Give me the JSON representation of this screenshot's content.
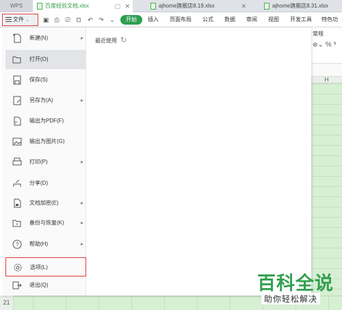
{
  "tabs": {
    "app_label": "WPS",
    "items": [
      {
        "label": "百度经验文档.xlsx"
      },
      {
        "label": "ajhome旗舰店8.19.xlsx"
      },
      {
        "label": "ajhome旗舰店8.31.xlsx"
      }
    ]
  },
  "menubar": {
    "file_label": "文件",
    "start_label": "开始",
    "items": [
      "插入",
      "页面布局",
      "公式",
      "数据",
      "审阅",
      "视图",
      "开发工具",
      "特色功"
    ]
  },
  "file_menu": {
    "recent_label": "最近使用",
    "items": [
      {
        "label": "新建(N)",
        "icon": "new-file-icon",
        "has_submenu": true
      },
      {
        "label": "打开(O)",
        "icon": "folder-open-icon",
        "has_submenu": false
      },
      {
        "label": "保存(S)",
        "icon": "save-icon",
        "has_submenu": false
      },
      {
        "label": "另存为(A)",
        "icon": "save-as-icon",
        "has_submenu": true
      },
      {
        "label": "输出为PDF(F)",
        "icon": "pdf-export-icon",
        "has_submenu": false
      },
      {
        "label": "输出为图片(G)",
        "icon": "image-export-icon",
        "has_submenu": false
      },
      {
        "label": "打印(P)",
        "icon": "print-icon",
        "has_submenu": true
      },
      {
        "label": "分享(D)",
        "icon": "share-icon",
        "has_submenu": false
      },
      {
        "label": "文档加密(E)",
        "icon": "lock-icon",
        "has_submenu": true
      },
      {
        "label": "备份与恢复(K)",
        "icon": "backup-icon",
        "has_submenu": true
      },
      {
        "label": "帮助(H)",
        "icon": "help-icon",
        "has_submenu": true
      },
      {
        "label": "选项(L)",
        "icon": "gear-icon",
        "has_submenu": false
      },
      {
        "label": "退出(Q)",
        "icon": "exit-icon",
        "has_submenu": false
      }
    ]
  },
  "sheet": {
    "number_format": "常规",
    "format_symbols": "% ⁹",
    "column_label": "H",
    "row_number": "21"
  },
  "watermark": {
    "title": "百科全说",
    "subtitle": "助你轻松解决"
  },
  "colors": {
    "accent_green": "#2e9e50",
    "highlight_red": "#e03c3c",
    "grid_green": "#d7efd3"
  }
}
